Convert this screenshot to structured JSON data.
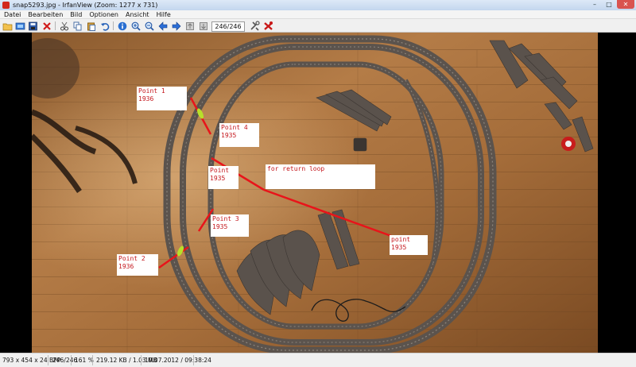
{
  "window": {
    "title": "snap5293.jpg - IrfanView (Zoom: 1277 x 731)",
    "buttons": {
      "minimize": "–",
      "maximize": "□",
      "close": "✕"
    }
  },
  "menu": [
    "Datei",
    "Bearbeiten",
    "Bild",
    "Optionen",
    "Ansicht",
    "Hilfe"
  ],
  "toolbar": {
    "counter": "246/246",
    "icons": [
      "open-folder-icon",
      "slideshow-icon",
      "save-icon",
      "delete-icon",
      "cut-icon",
      "copy-icon",
      "paste-icon",
      "undo-icon",
      "info-icon",
      "zoom-in-icon",
      "zoom-out-icon",
      "previous-icon",
      "next-icon",
      "first-image-icon",
      "last-image-icon",
      "settings-icon",
      "exit-icon"
    ]
  },
  "annotations": {
    "point1": [
      "Point 1",
      "1936"
    ],
    "point4": [
      "Point 4",
      "1935"
    ],
    "point_mid": [
      "Point",
      "1935"
    ],
    "return_loop": [
      "for return loop"
    ],
    "point3": [
      "Point 3",
      "1935"
    ],
    "point2": [
      "Point 2",
      "1936"
    ],
    "point_right": [
      "point",
      "1935"
    ]
  },
  "status": {
    "dimensions": "793 x 454 x 24 BPP",
    "index": "246/246",
    "zoom": "161 %",
    "filesize": "219.12 KB / 1.03 MB",
    "datetime": "10.07.2012 / 09:38:24"
  },
  "colors": {
    "floor_light": "#b07a45",
    "floor_dark": "#6a3f1c",
    "track": "#5d5550",
    "annotation_text": "#c4161c",
    "marker_line": "#e8141a",
    "marker_green": "#b8e02a"
  }
}
